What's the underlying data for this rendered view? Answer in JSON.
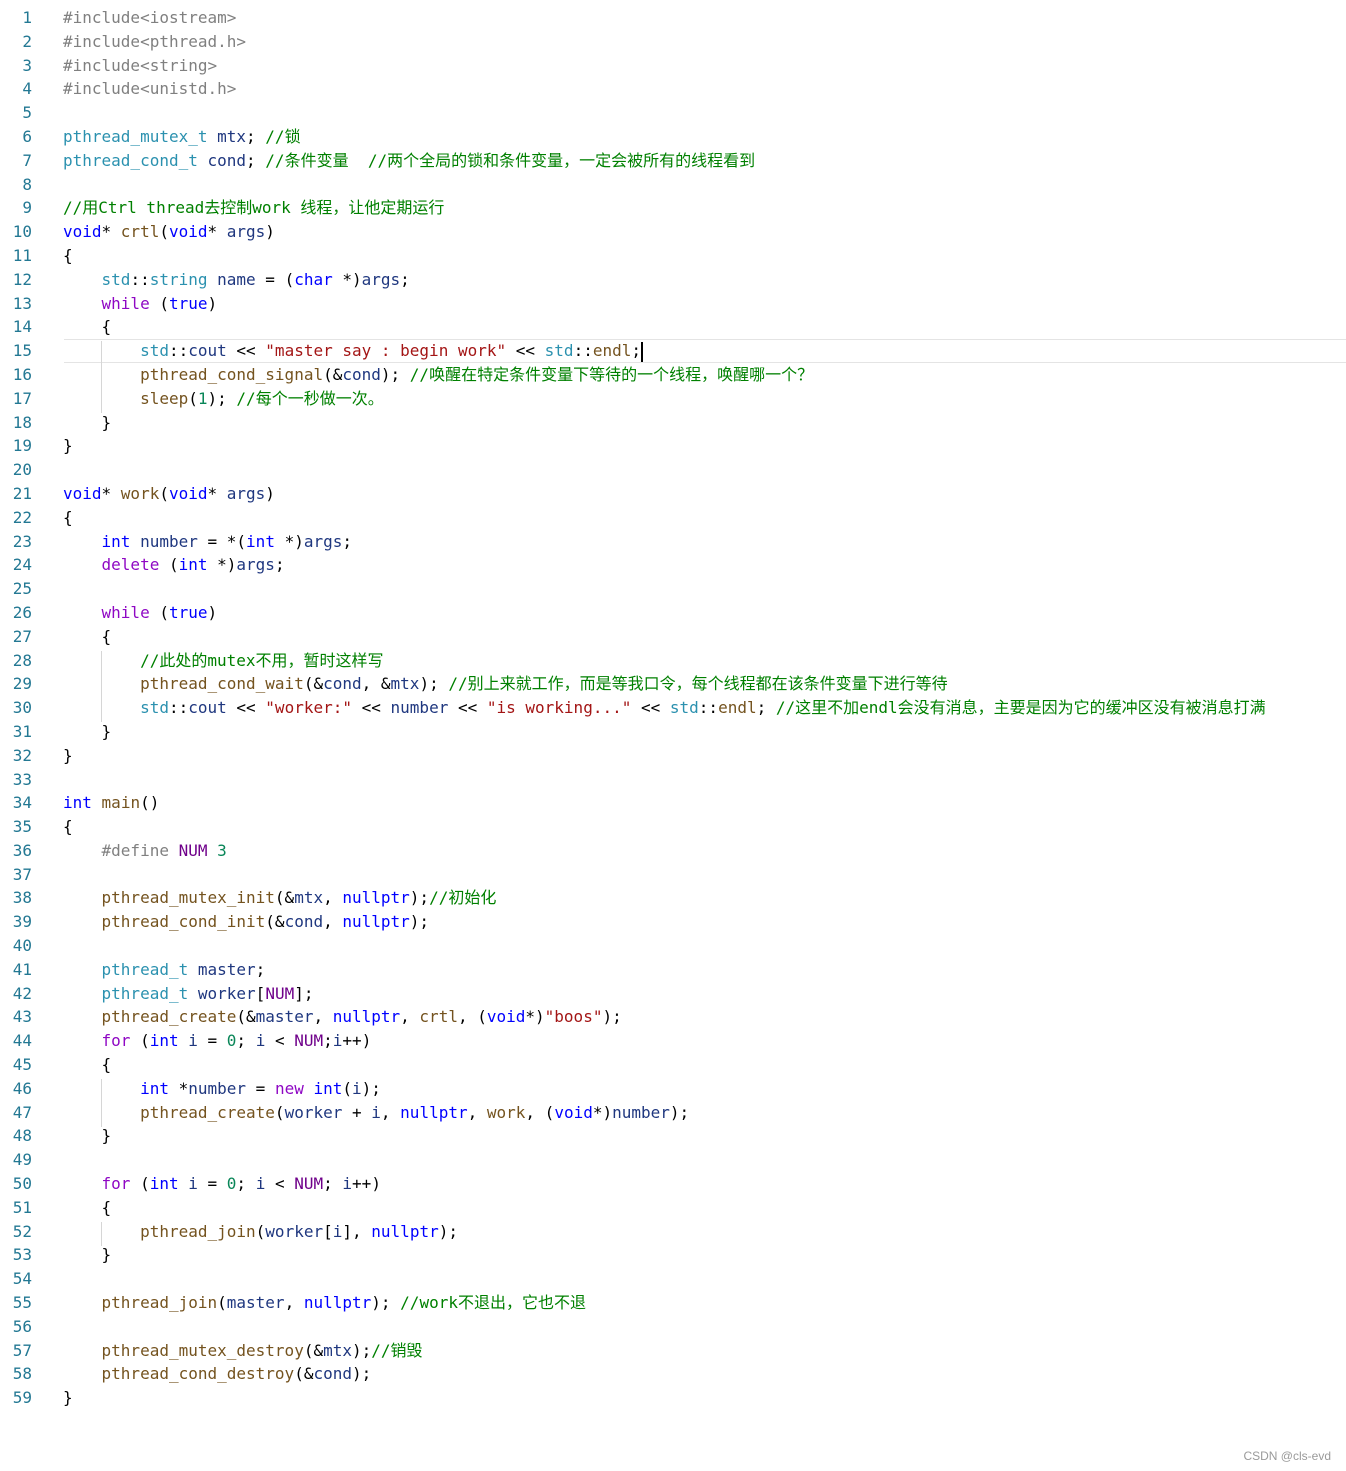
{
  "editor": {
    "current_line": 15,
    "lines": [
      {
        "n": "1",
        "t": [
          [
            "pp",
            "#include<iostream>"
          ]
        ]
      },
      {
        "n": "2",
        "t": [
          [
            "pp",
            "#include<pthread.h>"
          ]
        ]
      },
      {
        "n": "3",
        "t": [
          [
            "pp",
            "#include<string>"
          ]
        ]
      },
      {
        "n": "4",
        "t": [
          [
            "pp",
            "#include<unistd.h>"
          ]
        ]
      },
      {
        "n": "5",
        "t": []
      },
      {
        "n": "6",
        "t": [
          [
            "ty",
            "pthread_mutex_t"
          ],
          [
            "var",
            " mtx"
          ],
          [
            "op",
            "; "
          ],
          [
            "cm",
            "//锁"
          ]
        ]
      },
      {
        "n": "7",
        "t": [
          [
            "ty",
            "pthread_cond_t"
          ],
          [
            "var",
            " cond"
          ],
          [
            "op",
            "; "
          ],
          [
            "cm",
            "//条件变量  //两个全局的锁和条件变量，一定会被所有的线程看到"
          ]
        ]
      },
      {
        "n": "8",
        "t": []
      },
      {
        "n": "9",
        "t": [
          [
            "cm",
            "//用Ctrl thread去控制work 线程，让他定期运行"
          ]
        ]
      },
      {
        "n": "10",
        "t": [
          [
            "kw",
            "void"
          ],
          [
            "op",
            "* "
          ],
          [
            "fn",
            "crtl"
          ],
          [
            "op",
            "("
          ],
          [
            "kw",
            "void"
          ],
          [
            "op",
            "* "
          ],
          [
            "var",
            "args"
          ],
          [
            "op",
            ")"
          ]
        ]
      },
      {
        "n": "11",
        "t": [
          [
            "op",
            "{"
          ]
        ]
      },
      {
        "n": "12",
        "t": [
          [
            "op",
            "    "
          ],
          [
            "ty",
            "std"
          ],
          [
            "op",
            "::"
          ],
          [
            "ty",
            "string"
          ],
          [
            "var",
            " name"
          ],
          [
            "op",
            " = ("
          ],
          [
            "kw",
            "char"
          ],
          [
            "op",
            " *)"
          ],
          [
            "var",
            "args"
          ],
          [
            "op",
            ";"
          ]
        ]
      },
      {
        "n": "13",
        "t": [
          [
            "op",
            "    "
          ],
          [
            "ctl",
            "while"
          ],
          [
            "op",
            " ("
          ],
          [
            "kw",
            "true"
          ],
          [
            "op",
            ")"
          ]
        ]
      },
      {
        "n": "14",
        "t": [
          [
            "op",
            "    {"
          ]
        ]
      },
      {
        "n": "15",
        "t": [
          [
            "op",
            "        "
          ],
          [
            "ty",
            "std"
          ],
          [
            "op",
            "::"
          ],
          [
            "var",
            "cout"
          ],
          [
            "op",
            " << "
          ],
          [
            "str",
            "\"master say : begin work\""
          ],
          [
            "op",
            " << "
          ],
          [
            "ty",
            "std"
          ],
          [
            "op",
            "::"
          ],
          [
            "fn",
            "endl"
          ],
          [
            "op",
            ";"
          ]
        ]
      },
      {
        "n": "16",
        "t": [
          [
            "op",
            "        "
          ],
          [
            "fn",
            "pthread_cond_signal"
          ],
          [
            "op",
            "(&"
          ],
          [
            "var",
            "cond"
          ],
          [
            "op",
            "); "
          ],
          [
            "cm",
            "//唤醒在特定条件变量下等待的一个线程，唤醒哪一个？"
          ]
        ]
      },
      {
        "n": "17",
        "t": [
          [
            "op",
            "        "
          ],
          [
            "fn",
            "sleep"
          ],
          [
            "op",
            "("
          ],
          [
            "num",
            "1"
          ],
          [
            "op",
            "); "
          ],
          [
            "cm",
            "//每个一秒做一次。"
          ]
        ]
      },
      {
        "n": "18",
        "t": [
          [
            "op",
            "    }"
          ]
        ]
      },
      {
        "n": "19",
        "t": [
          [
            "op",
            "}"
          ]
        ]
      },
      {
        "n": "20",
        "t": []
      },
      {
        "n": "21",
        "t": [
          [
            "kw",
            "void"
          ],
          [
            "op",
            "* "
          ],
          [
            "fn",
            "work"
          ],
          [
            "op",
            "("
          ],
          [
            "kw",
            "void"
          ],
          [
            "op",
            "* "
          ],
          [
            "var",
            "args"
          ],
          [
            "op",
            ")"
          ]
        ]
      },
      {
        "n": "22",
        "t": [
          [
            "op",
            "{"
          ]
        ]
      },
      {
        "n": "23",
        "t": [
          [
            "op",
            "    "
          ],
          [
            "kw",
            "int"
          ],
          [
            "var",
            " number"
          ],
          [
            "op",
            " = *("
          ],
          [
            "kw",
            "int"
          ],
          [
            "op",
            " *)"
          ],
          [
            "var",
            "args"
          ],
          [
            "op",
            ";"
          ]
        ]
      },
      {
        "n": "24",
        "t": [
          [
            "op",
            "    "
          ],
          [
            "ctl",
            "delete"
          ],
          [
            "op",
            " ("
          ],
          [
            "kw",
            "int"
          ],
          [
            "op",
            " *)"
          ],
          [
            "var",
            "args"
          ],
          [
            "op",
            ";"
          ]
        ]
      },
      {
        "n": "25",
        "t": []
      },
      {
        "n": "26",
        "t": [
          [
            "op",
            "    "
          ],
          [
            "ctl",
            "while"
          ],
          [
            "op",
            " ("
          ],
          [
            "kw",
            "true"
          ],
          [
            "op",
            ")"
          ]
        ]
      },
      {
        "n": "27",
        "t": [
          [
            "op",
            "    {"
          ]
        ]
      },
      {
        "n": "28",
        "t": [
          [
            "op",
            "        "
          ],
          [
            "cm",
            "//此处的mutex不用，暂时这样写"
          ]
        ]
      },
      {
        "n": "29",
        "t": [
          [
            "op",
            "        "
          ],
          [
            "fn",
            "pthread_cond_wait"
          ],
          [
            "op",
            "(&"
          ],
          [
            "var",
            "cond"
          ],
          [
            "op",
            ", &"
          ],
          [
            "var",
            "mtx"
          ],
          [
            "op",
            "); "
          ],
          [
            "cm",
            "//别上来就工作，而是等我口令，每个线程都在该条件变量下进行等待"
          ]
        ]
      },
      {
        "n": "30",
        "t": [
          [
            "op",
            "        "
          ],
          [
            "ty",
            "std"
          ],
          [
            "op",
            "::"
          ],
          [
            "var",
            "cout"
          ],
          [
            "op",
            " << "
          ],
          [
            "str",
            "\"worker:\""
          ],
          [
            "op",
            " << "
          ],
          [
            "var",
            "number"
          ],
          [
            "op",
            " << "
          ],
          [
            "str",
            "\"is working...\""
          ],
          [
            "op",
            " << "
          ],
          [
            "ty",
            "std"
          ],
          [
            "op",
            "::"
          ],
          [
            "fn",
            "endl"
          ],
          [
            "op",
            "; "
          ],
          [
            "cm",
            "//这里不加endl会没有消息，主要是因为它的缓冲区没有被消息打满"
          ]
        ]
      },
      {
        "n": "31",
        "t": [
          [
            "op",
            "    }"
          ]
        ]
      },
      {
        "n": "32",
        "t": [
          [
            "op",
            "}"
          ]
        ]
      },
      {
        "n": "33",
        "t": []
      },
      {
        "n": "34",
        "t": [
          [
            "kw",
            "int"
          ],
          [
            "op",
            " "
          ],
          [
            "fn",
            "main"
          ],
          [
            "op",
            "()"
          ]
        ]
      },
      {
        "n": "35",
        "t": [
          [
            "op",
            "{"
          ]
        ]
      },
      {
        "n": "36",
        "t": [
          [
            "op",
            "    "
          ],
          [
            "pp",
            "#define"
          ],
          [
            "op",
            " "
          ],
          [
            "mac",
            "NUM"
          ],
          [
            "op",
            " "
          ],
          [
            "num",
            "3"
          ]
        ]
      },
      {
        "n": "37",
        "t": []
      },
      {
        "n": "38",
        "t": [
          [
            "op",
            "    "
          ],
          [
            "fn",
            "pthread_mutex_init"
          ],
          [
            "op",
            "(&"
          ],
          [
            "var",
            "mtx"
          ],
          [
            "op",
            ", "
          ],
          [
            "kw",
            "nullptr"
          ],
          [
            "op",
            ");"
          ],
          [
            "cm",
            "//初始化"
          ]
        ]
      },
      {
        "n": "39",
        "t": [
          [
            "op",
            "    "
          ],
          [
            "fn",
            "pthread_cond_init"
          ],
          [
            "op",
            "(&"
          ],
          [
            "var",
            "cond"
          ],
          [
            "op",
            ", "
          ],
          [
            "kw",
            "nullptr"
          ],
          [
            "op",
            ");"
          ]
        ]
      },
      {
        "n": "40",
        "t": []
      },
      {
        "n": "41",
        "t": [
          [
            "op",
            "    "
          ],
          [
            "ty",
            "pthread_t"
          ],
          [
            "var",
            " master"
          ],
          [
            "op",
            ";"
          ]
        ]
      },
      {
        "n": "42",
        "t": [
          [
            "op",
            "    "
          ],
          [
            "ty",
            "pthread_t"
          ],
          [
            "var",
            " worker"
          ],
          [
            "op",
            "["
          ],
          [
            "mac",
            "NUM"
          ],
          [
            "op",
            "];"
          ]
        ]
      },
      {
        "n": "43",
        "t": [
          [
            "op",
            "    "
          ],
          [
            "fn",
            "pthread_create"
          ],
          [
            "op",
            "(&"
          ],
          [
            "var",
            "master"
          ],
          [
            "op",
            ", "
          ],
          [
            "kw",
            "nullptr"
          ],
          [
            "op",
            ", "
          ],
          [
            "fn",
            "crtl"
          ],
          [
            "op",
            ", ("
          ],
          [
            "kw",
            "void"
          ],
          [
            "op",
            "*)"
          ],
          [
            "str",
            "\"boos\""
          ],
          [
            "op",
            ");"
          ]
        ]
      },
      {
        "n": "44",
        "t": [
          [
            "op",
            "    "
          ],
          [
            "ctl",
            "for"
          ],
          [
            "op",
            " ("
          ],
          [
            "kw",
            "int"
          ],
          [
            "var",
            " i"
          ],
          [
            "op",
            " = "
          ],
          [
            "num",
            "0"
          ],
          [
            "op",
            "; "
          ],
          [
            "var",
            "i"
          ],
          [
            "op",
            " < "
          ],
          [
            "mac",
            "NUM"
          ],
          [
            "op",
            ";"
          ],
          [
            "var",
            "i"
          ],
          [
            "op",
            "++)"
          ]
        ]
      },
      {
        "n": "45",
        "t": [
          [
            "op",
            "    {"
          ]
        ]
      },
      {
        "n": "46",
        "t": [
          [
            "op",
            "        "
          ],
          [
            "kw",
            "int"
          ],
          [
            "op",
            " *"
          ],
          [
            "var",
            "number"
          ],
          [
            "op",
            " = "
          ],
          [
            "ctl",
            "new"
          ],
          [
            "op",
            " "
          ],
          [
            "kw",
            "int"
          ],
          [
            "op",
            "("
          ],
          [
            "var",
            "i"
          ],
          [
            "op",
            ");"
          ]
        ]
      },
      {
        "n": "47",
        "t": [
          [
            "op",
            "        "
          ],
          [
            "fn",
            "pthread_create"
          ],
          [
            "op",
            "("
          ],
          [
            "var",
            "worker"
          ],
          [
            "op",
            " + "
          ],
          [
            "var",
            "i"
          ],
          [
            "op",
            ", "
          ],
          [
            "kw",
            "nullptr"
          ],
          [
            "op",
            ", "
          ],
          [
            "fn",
            "work"
          ],
          [
            "op",
            ", ("
          ],
          [
            "kw",
            "void"
          ],
          [
            "op",
            "*)"
          ],
          [
            "var",
            "number"
          ],
          [
            "op",
            ");"
          ]
        ]
      },
      {
        "n": "48",
        "t": [
          [
            "op",
            "    }"
          ]
        ]
      },
      {
        "n": "49",
        "t": []
      },
      {
        "n": "50",
        "t": [
          [
            "op",
            "    "
          ],
          [
            "ctl",
            "for"
          ],
          [
            "op",
            " ("
          ],
          [
            "kw",
            "int"
          ],
          [
            "var",
            " i"
          ],
          [
            "op",
            " = "
          ],
          [
            "num",
            "0"
          ],
          [
            "op",
            "; "
          ],
          [
            "var",
            "i"
          ],
          [
            "op",
            " < "
          ],
          [
            "mac",
            "NUM"
          ],
          [
            "op",
            "; "
          ],
          [
            "var",
            "i"
          ],
          [
            "op",
            "++)"
          ]
        ]
      },
      {
        "n": "51",
        "t": [
          [
            "op",
            "    {"
          ]
        ]
      },
      {
        "n": "52",
        "t": [
          [
            "op",
            "        "
          ],
          [
            "fn",
            "pthread_join"
          ],
          [
            "op",
            "("
          ],
          [
            "var",
            "worker"
          ],
          [
            "op",
            "["
          ],
          [
            "var",
            "i"
          ],
          [
            "op",
            "], "
          ],
          [
            "kw",
            "nullptr"
          ],
          [
            "op",
            ");"
          ]
        ]
      },
      {
        "n": "53",
        "t": [
          [
            "op",
            "    }"
          ]
        ]
      },
      {
        "n": "54",
        "t": []
      },
      {
        "n": "55",
        "t": [
          [
            "op",
            "    "
          ],
          [
            "fn",
            "pthread_join"
          ],
          [
            "op",
            "("
          ],
          [
            "var",
            "master"
          ],
          [
            "op",
            ", "
          ],
          [
            "kw",
            "nullptr"
          ],
          [
            "op",
            "); "
          ],
          [
            "cm",
            "//work不退出，它也不退"
          ]
        ]
      },
      {
        "n": "56",
        "t": []
      },
      {
        "n": "57",
        "t": [
          [
            "op",
            "    "
          ],
          [
            "fn",
            "pthread_mutex_destroy"
          ],
          [
            "op",
            "(&"
          ],
          [
            "var",
            "mtx"
          ],
          [
            "op",
            ");"
          ],
          [
            "cm",
            "//销毁"
          ]
        ]
      },
      {
        "n": "58",
        "t": [
          [
            "op",
            "    "
          ],
          [
            "fn",
            "pthread_cond_destroy"
          ],
          [
            "op",
            "(&"
          ],
          [
            "var",
            "cond"
          ],
          [
            "op",
            ");"
          ]
        ]
      },
      {
        "n": "59",
        "t": [
          [
            "op",
            "}"
          ]
        ]
      }
    ]
  },
  "watermark": "CSDN @cls-evd"
}
